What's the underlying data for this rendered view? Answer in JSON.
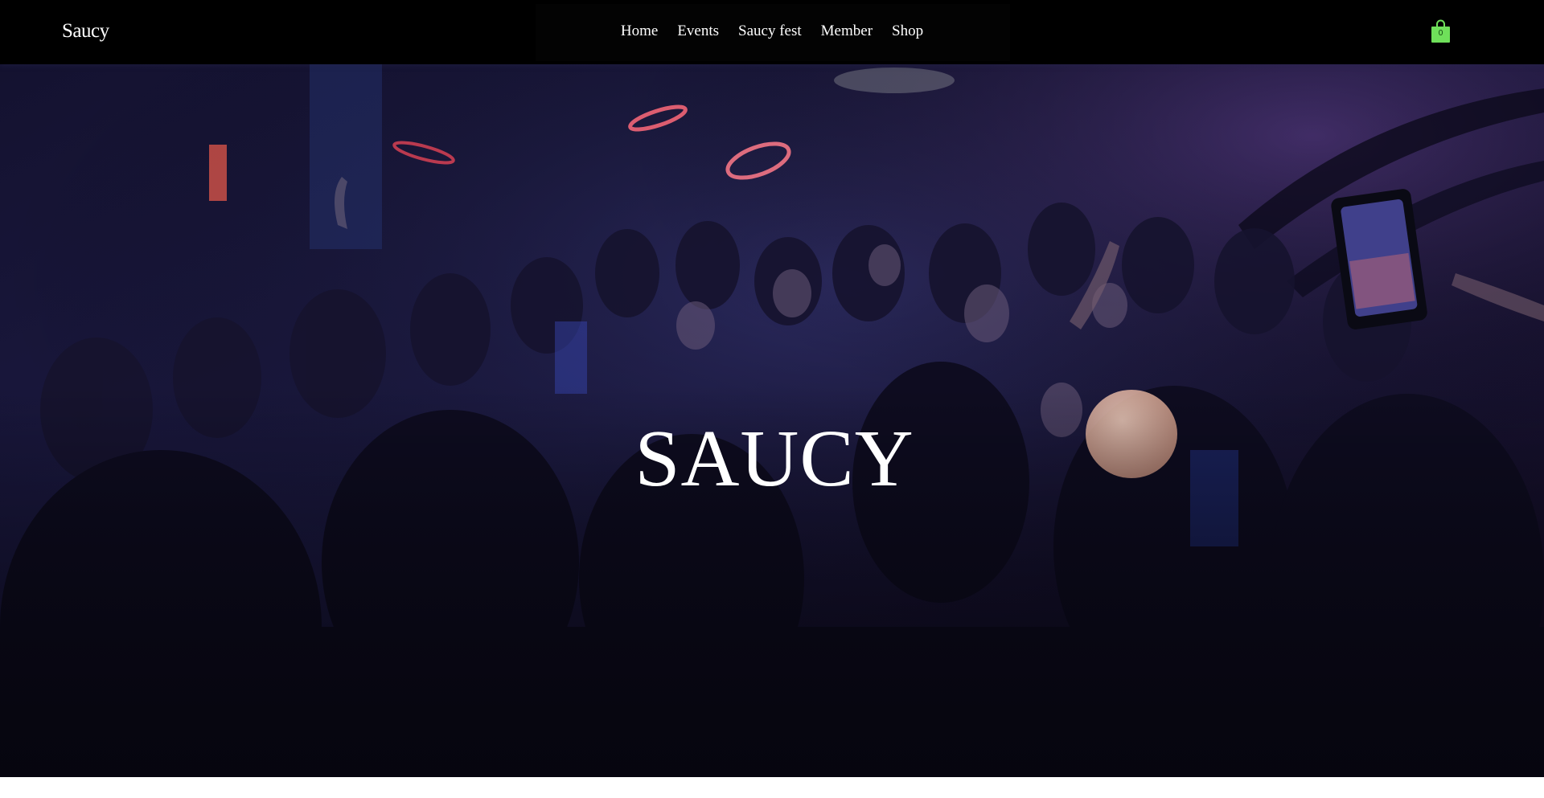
{
  "header": {
    "logo": "Saucy",
    "nav": [
      "Home",
      "Events",
      "Saucy fest",
      "Member",
      "Shop"
    ],
    "cart": {
      "icon": "shopping-bag-icon",
      "count": "0",
      "color": "#6fe05a"
    }
  },
  "hero": {
    "title": "SAUCY",
    "background": "nightclub-crowd-photo"
  },
  "colors": {
    "header_bg": "#000000",
    "text": "#ffffff",
    "cart_accent": "#6fe05a"
  }
}
